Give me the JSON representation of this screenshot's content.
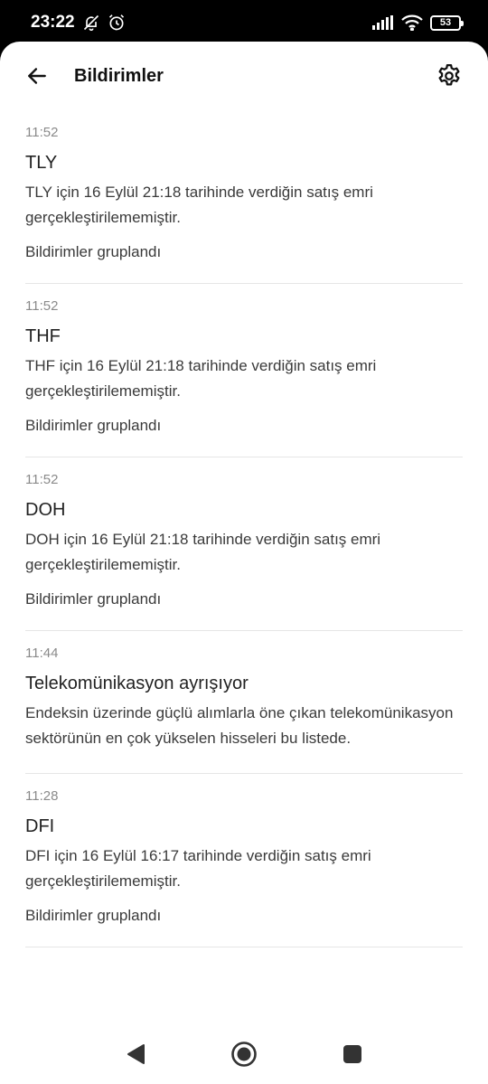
{
  "status_bar": {
    "time": "23:22",
    "battery": "53",
    "icons": [
      "bell-off-icon",
      "alarm-icon",
      "signal-icon",
      "wifi-icon",
      "battery-icon"
    ]
  },
  "app_bar": {
    "title": "Bildirimler",
    "back_icon": "arrow-left-icon",
    "settings_icon": "gear-icon"
  },
  "notifications": [
    {
      "time": "11:52",
      "title": "TLY",
      "body": "TLY için 16 Eylül 21:18 tarihinde verdiğin satış emri gerçekleştirilememiştir.",
      "group": "Bildirimler gruplandı"
    },
    {
      "time": "11:52",
      "title": "THF",
      "body": "THF için 16 Eylül 21:18 tarihinde verdiğin satış emri gerçekleştirilememiştir.",
      "group": "Bildirimler gruplandı"
    },
    {
      "time": "11:52",
      "title": "DOH",
      "body": "DOH için 16 Eylül 21:18 tarihinde verdiğin satış emri gerçekleştirilememiştir.",
      "group": "Bildirimler gruplandı"
    },
    {
      "time": "11:44",
      "title": "Telekomünikasyon ayrışıyor",
      "body": "Endeksin üzerinde güçlü alımlarla öne çıkan telekomünikasyon sektörünün en çok yükselen hisseleri bu listede.",
      "group": ""
    },
    {
      "time": "11:28",
      "title": "DFI",
      "body": "DFI için 16 Eylül 16:17 tarihinde verdiğin satış emri gerçekleştirilememiştir.",
      "group": "Bildirimler gruplandı"
    }
  ],
  "nav_bar": {
    "icons": [
      "nav-back-icon",
      "nav-home-icon",
      "nav-recents-icon"
    ]
  }
}
